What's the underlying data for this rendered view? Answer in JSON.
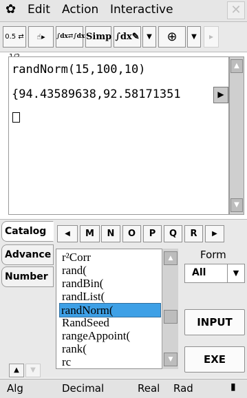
{
  "menubar": {
    "gear_icon": "gear-icon",
    "items": [
      "Edit",
      "Action",
      "Interactive"
    ],
    "close_icon": "✕"
  },
  "toolbar": {
    "buttons": [
      {
        "id": "fraction-decimal",
        "label": "0.5 ⇄ 1/2"
      },
      {
        "id": "drag-hand",
        "label": "☝▸"
      },
      {
        "id": "integral-dx",
        "label": "∫dx⇄∫dx"
      },
      {
        "id": "simp",
        "label": "Simp"
      },
      {
        "id": "integral-edit",
        "label": "∫dx✎"
      },
      {
        "id": "dropdown-1",
        "label": "▼"
      },
      {
        "id": "graph",
        "label": "⊕"
      },
      {
        "id": "dropdown-2",
        "label": "▼"
      },
      {
        "id": "next",
        "label": "▸"
      }
    ]
  },
  "work": {
    "input_line": "randNorm(15,100,10)",
    "output_line": "{94.43589638,92.58171351",
    "more_icon": "▶"
  },
  "catalog": {
    "side_tabs": [
      "Catalog",
      "Advance",
      "Number"
    ],
    "letters": [
      "◀",
      "M",
      "N",
      "O",
      "P",
      "Q",
      "R",
      "▶"
    ],
    "items": [
      "r²Corr",
      "rand(",
      "randBin(",
      "randList(",
      "randNorm(",
      "RandSeed",
      "rangeAppoint(",
      "rank(",
      "rc"
    ],
    "selected_index": 4,
    "form_label": "Form",
    "form_value": "All",
    "input_button": "INPUT",
    "exe_button": "EXE"
  },
  "status": {
    "items": [
      "Alg",
      "Decimal",
      "Real",
      "Rad"
    ]
  }
}
